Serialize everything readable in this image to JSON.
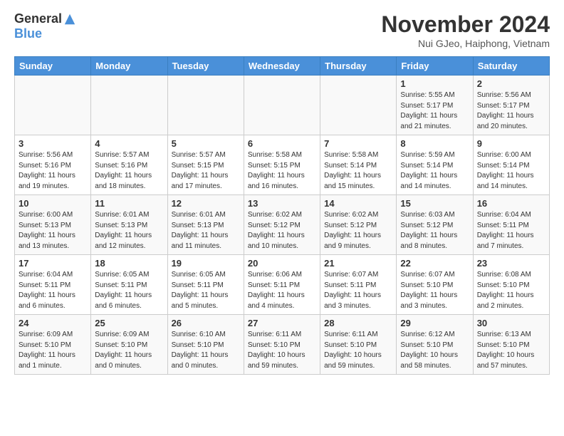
{
  "logo": {
    "general": "General",
    "blue": "Blue"
  },
  "title": "November 2024",
  "subtitle": "Nui GJeo, Haiphong, Vietnam",
  "weekdays": [
    "Sunday",
    "Monday",
    "Tuesday",
    "Wednesday",
    "Thursday",
    "Friday",
    "Saturday"
  ],
  "weeks": [
    [
      {
        "day": "",
        "info": ""
      },
      {
        "day": "",
        "info": ""
      },
      {
        "day": "",
        "info": ""
      },
      {
        "day": "",
        "info": ""
      },
      {
        "day": "",
        "info": ""
      },
      {
        "day": "1",
        "info": "Sunrise: 5:55 AM\nSunset: 5:17 PM\nDaylight: 11 hours\nand 21 minutes."
      },
      {
        "day": "2",
        "info": "Sunrise: 5:56 AM\nSunset: 5:17 PM\nDaylight: 11 hours\nand 20 minutes."
      }
    ],
    [
      {
        "day": "3",
        "info": "Sunrise: 5:56 AM\nSunset: 5:16 PM\nDaylight: 11 hours\nand 19 minutes."
      },
      {
        "day": "4",
        "info": "Sunrise: 5:57 AM\nSunset: 5:16 PM\nDaylight: 11 hours\nand 18 minutes."
      },
      {
        "day": "5",
        "info": "Sunrise: 5:57 AM\nSunset: 5:15 PM\nDaylight: 11 hours\nand 17 minutes."
      },
      {
        "day": "6",
        "info": "Sunrise: 5:58 AM\nSunset: 5:15 PM\nDaylight: 11 hours\nand 16 minutes."
      },
      {
        "day": "7",
        "info": "Sunrise: 5:58 AM\nSunset: 5:14 PM\nDaylight: 11 hours\nand 15 minutes."
      },
      {
        "day": "8",
        "info": "Sunrise: 5:59 AM\nSunset: 5:14 PM\nDaylight: 11 hours\nand 14 minutes."
      },
      {
        "day": "9",
        "info": "Sunrise: 6:00 AM\nSunset: 5:14 PM\nDaylight: 11 hours\nand 14 minutes."
      }
    ],
    [
      {
        "day": "10",
        "info": "Sunrise: 6:00 AM\nSunset: 5:13 PM\nDaylight: 11 hours\nand 13 minutes."
      },
      {
        "day": "11",
        "info": "Sunrise: 6:01 AM\nSunset: 5:13 PM\nDaylight: 11 hours\nand 12 minutes."
      },
      {
        "day": "12",
        "info": "Sunrise: 6:01 AM\nSunset: 5:13 PM\nDaylight: 11 hours\nand 11 minutes."
      },
      {
        "day": "13",
        "info": "Sunrise: 6:02 AM\nSunset: 5:12 PM\nDaylight: 11 hours\nand 10 minutes."
      },
      {
        "day": "14",
        "info": "Sunrise: 6:02 AM\nSunset: 5:12 PM\nDaylight: 11 hours\nand 9 minutes."
      },
      {
        "day": "15",
        "info": "Sunrise: 6:03 AM\nSunset: 5:12 PM\nDaylight: 11 hours\nand 8 minutes."
      },
      {
        "day": "16",
        "info": "Sunrise: 6:04 AM\nSunset: 5:11 PM\nDaylight: 11 hours\nand 7 minutes."
      }
    ],
    [
      {
        "day": "17",
        "info": "Sunrise: 6:04 AM\nSunset: 5:11 PM\nDaylight: 11 hours\nand 6 minutes."
      },
      {
        "day": "18",
        "info": "Sunrise: 6:05 AM\nSunset: 5:11 PM\nDaylight: 11 hours\nand 6 minutes."
      },
      {
        "day": "19",
        "info": "Sunrise: 6:05 AM\nSunset: 5:11 PM\nDaylight: 11 hours\nand 5 minutes."
      },
      {
        "day": "20",
        "info": "Sunrise: 6:06 AM\nSunset: 5:11 PM\nDaylight: 11 hours\nand 4 minutes."
      },
      {
        "day": "21",
        "info": "Sunrise: 6:07 AM\nSunset: 5:11 PM\nDaylight: 11 hours\nand 3 minutes."
      },
      {
        "day": "22",
        "info": "Sunrise: 6:07 AM\nSunset: 5:10 PM\nDaylight: 11 hours\nand 3 minutes."
      },
      {
        "day": "23",
        "info": "Sunrise: 6:08 AM\nSunset: 5:10 PM\nDaylight: 11 hours\nand 2 minutes."
      }
    ],
    [
      {
        "day": "24",
        "info": "Sunrise: 6:09 AM\nSunset: 5:10 PM\nDaylight: 11 hours\nand 1 minute."
      },
      {
        "day": "25",
        "info": "Sunrise: 6:09 AM\nSunset: 5:10 PM\nDaylight: 11 hours\nand 0 minutes."
      },
      {
        "day": "26",
        "info": "Sunrise: 6:10 AM\nSunset: 5:10 PM\nDaylight: 11 hours\nand 0 minutes."
      },
      {
        "day": "27",
        "info": "Sunrise: 6:11 AM\nSunset: 5:10 PM\nDaylight: 10 hours\nand 59 minutes."
      },
      {
        "day": "28",
        "info": "Sunrise: 6:11 AM\nSunset: 5:10 PM\nDaylight: 10 hours\nand 59 minutes."
      },
      {
        "day": "29",
        "info": "Sunrise: 6:12 AM\nSunset: 5:10 PM\nDaylight: 10 hours\nand 58 minutes."
      },
      {
        "day": "30",
        "info": "Sunrise: 6:13 AM\nSunset: 5:10 PM\nDaylight: 10 hours\nand 57 minutes."
      }
    ]
  ]
}
